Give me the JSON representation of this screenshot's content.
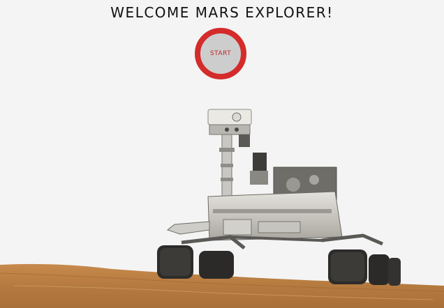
{
  "header": {
    "title": "WELCOME MARS EXPLORER!"
  },
  "start": {
    "label": "START"
  },
  "colors": {
    "background": "#f4f4f4",
    "accent": "#d42b2b",
    "button_fill": "#cdcdcd",
    "ground": "#c98a4a"
  }
}
